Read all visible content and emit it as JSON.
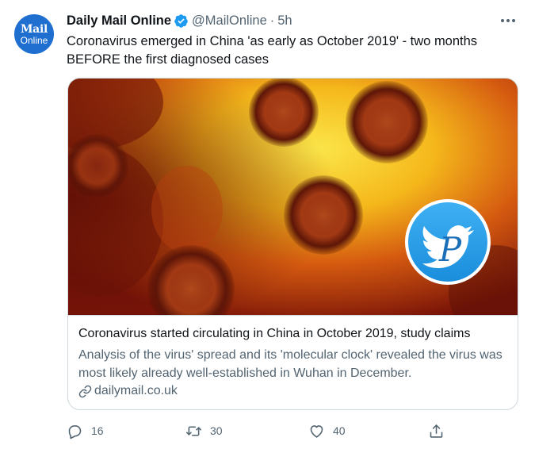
{
  "author": {
    "avatar_line1": "Mail",
    "avatar_line2": "Online",
    "display_name": "Daily Mail Online",
    "handle": "@MailOnline",
    "separator": "·",
    "time": "5h"
  },
  "tweet": {
    "text": "Coronavirus emerged in China 'as early as October 2019' - two months BEFORE the first diagnosed cases"
  },
  "card": {
    "title": "Coronavirus started circulating in China in October 2019, study claims",
    "description": "Analysis of the virus' spread and its 'molecular clock' revealed the virus was most likely already well-established in Wuhan in December.",
    "domain": "dailymail.co.uk",
    "watermark_letter": "P"
  },
  "actions": {
    "reply_count": "16",
    "retweet_count": "30",
    "like_count": "40"
  },
  "colors": {
    "brand_blue": "#1d9bf0",
    "text_primary": "#0f1419",
    "text_secondary": "#536471",
    "border": "#cfd9de",
    "avatar_bg": "#1e6fd0"
  },
  "icons": [
    "verified-badge-icon",
    "more-options-icon",
    "link-icon",
    "reply-icon",
    "retweet-icon",
    "like-icon",
    "share-icon",
    "twitter-bird-watermark-icon"
  ]
}
